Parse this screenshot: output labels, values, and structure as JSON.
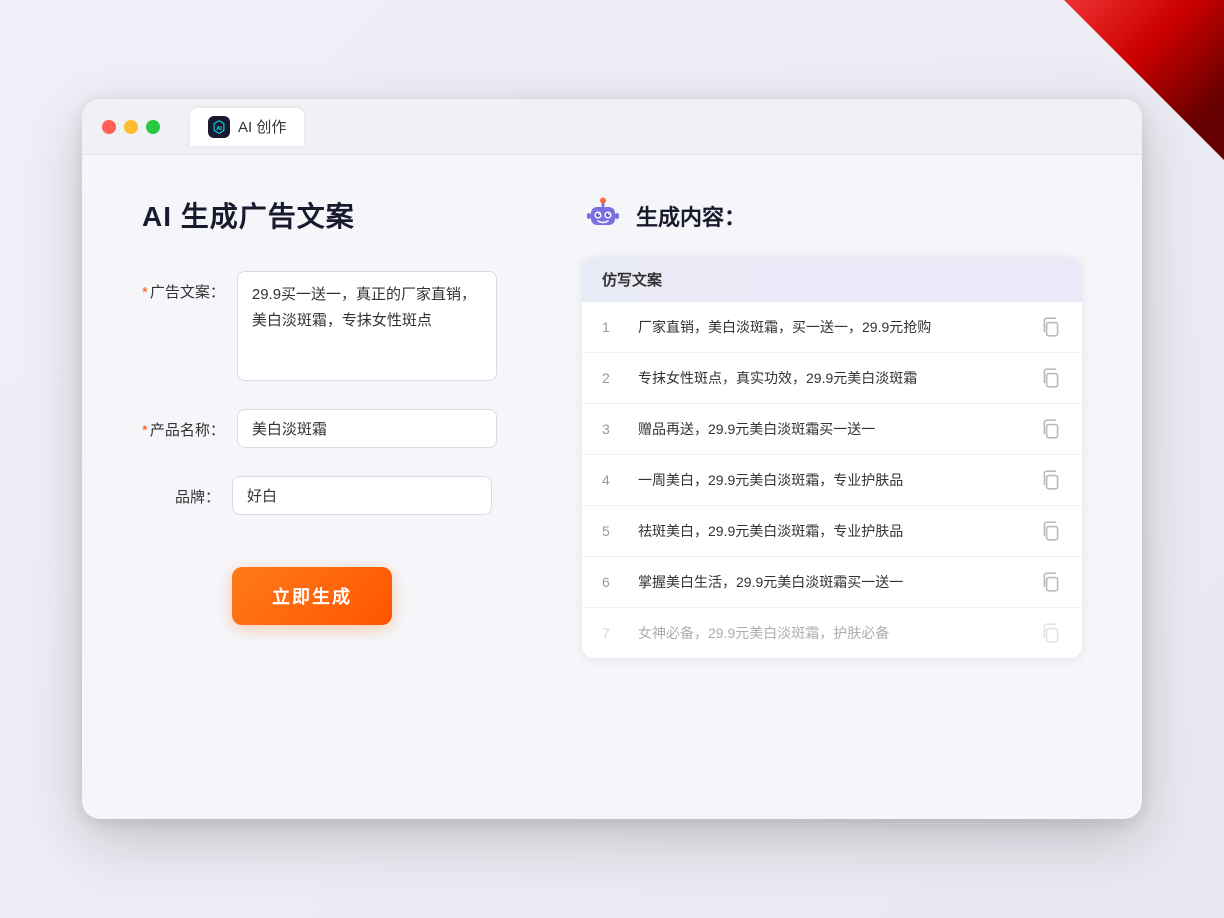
{
  "browser": {
    "tab_label": "AI 创作"
  },
  "page": {
    "title": "AI 生成广告文案",
    "result_title": "生成内容："
  },
  "form": {
    "ad_copy_label": "广告文案：",
    "ad_copy_required": "*",
    "ad_copy_value": "29.9买一送一，真正的厂家直销，美白淡斑霜，专抹女性斑点",
    "product_label": "产品名称：",
    "product_required": "*",
    "product_value": "美白淡斑霜",
    "brand_label": "品牌：",
    "brand_value": "好白",
    "generate_btn": "立即生成"
  },
  "results": {
    "column_header": "仿写文案",
    "rows": [
      {
        "num": 1,
        "text": "厂家直销，美白淡斑霜，买一送一，29.9元抢购"
      },
      {
        "num": 2,
        "text": "专抹女性斑点，真实功效，29.9元美白淡斑霜"
      },
      {
        "num": 3,
        "text": "赠品再送，29.9元美白淡斑霜买一送一"
      },
      {
        "num": 4,
        "text": "一周美白，29.9元美白淡斑霜，专业护肤品"
      },
      {
        "num": 5,
        "text": "祛斑美白，29.9元美白淡斑霜，专业护肤品"
      },
      {
        "num": 6,
        "text": "掌握美白生活，29.9元美白淡斑霜买一送一"
      },
      {
        "num": 7,
        "text": "女神必备，29.9元美白淡斑霜，护肤必备"
      }
    ]
  }
}
